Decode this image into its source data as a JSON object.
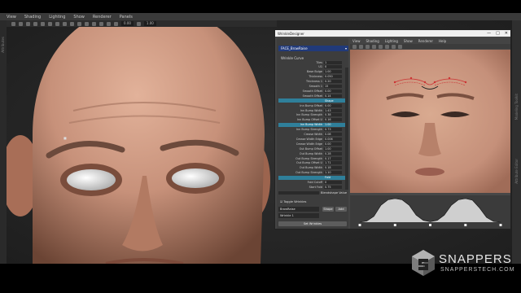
{
  "maya": {
    "menu": [
      "View",
      "Shading",
      "Lighting",
      "Show",
      "Renderer",
      "Panels"
    ],
    "toolbar_fields": [
      "0.00",
      "1.00"
    ],
    "left_strip": "Attributes",
    "right_strip_top": "Modeling Toolkit",
    "right_strip_bottom": "Attribute Editor"
  },
  "tool_window": {
    "title": "WrinkleDesigner",
    "window_buttons": [
      "—",
      "□",
      "✕"
    ],
    "dropdown_value": "FACE_BrowRaise",
    "section_label": "Wrinkle Curve",
    "attributes": [
      {
        "label": "Tiles",
        "value": "1"
      },
      {
        "label": "U1",
        "value": "0"
      },
      {
        "label": "Base Bulge",
        "value": "1.00"
      },
      {
        "label": "Thickness",
        "value": "0.050"
      },
      {
        "label": "Thickness 1",
        "value": "0.20"
      },
      {
        "label": "Smooth 1",
        "value": "15"
      },
      {
        "label": "Smooth Offset",
        "value": "0.00"
      },
      {
        "label": "Smooth Offset",
        "value": "0.14"
      },
      {
        "label": "",
        "value": "Shape",
        "sel": true
      },
      {
        "label": "Inn Bump Offset",
        "value": "0.00"
      },
      {
        "label": "Inn Bump Width",
        "value": "1.43"
      },
      {
        "label": "Inn Bump Strength",
        "value": "0.38"
      },
      {
        "label": "Inn Bump Offset U",
        "value": "0.16"
      },
      {
        "label": "Inn Bump Width",
        "value": "1.00",
        "sel": true
      },
      {
        "label": "Inn Bump Strength",
        "value": "0.73"
      },
      {
        "label": "Crease Width",
        "value": "0.08"
      },
      {
        "label": "Crease Width Edge",
        "value": "0.006"
      },
      {
        "label": "Crease Width Edge",
        "value": "0.00"
      },
      {
        "label": "Out Bump Offset",
        "value": "1.00"
      },
      {
        "label": "Out Bump Width",
        "value": "0.28"
      },
      {
        "label": "Out Bump Strength",
        "value": "0.17"
      },
      {
        "label": "Out Bump Offset U",
        "value": "1.71"
      },
      {
        "label": "Out Bump Width",
        "value": "0.18"
      },
      {
        "label": "Out Bump Strength",
        "value": "1.10"
      },
      {
        "label": "",
        "value": "Fold",
        "sel": true
      },
      {
        "label": "Fold Cutoff",
        "value": "0"
      },
      {
        "label": "Start Fold",
        "value": "0.75"
      }
    ],
    "blendshape_label": "Blendshape Value",
    "toggle_label": "Toggle Wrinkles",
    "combo1": "BrowRaise",
    "combo2": "Wrinkle 1",
    "shape_btn": "Shape",
    "add_btn": "Add",
    "set_btn": "Set Wrinkles",
    "viewport_menu": [
      "View",
      "Shading",
      "Lighting",
      "Show",
      "Renderer",
      "Help"
    ],
    "curve_points": [
      0.0,
      0.05,
      0.25,
      0.72,
      0.95,
      1.0,
      0.95,
      0.72,
      0.3,
      0.08,
      0.02,
      0.08,
      0.3,
      0.72,
      0.95,
      1.0,
      0.93,
      0.6,
      0.2,
      0.03,
      0.0
    ]
  },
  "logo": {
    "brand": "SNAPPERS",
    "site": "SNAPPERSTECH.COM"
  },
  "colors": {
    "accent_blue": "#213a7a",
    "selection_teal": "#2f7f9a",
    "skin": "#c79378"
  }
}
